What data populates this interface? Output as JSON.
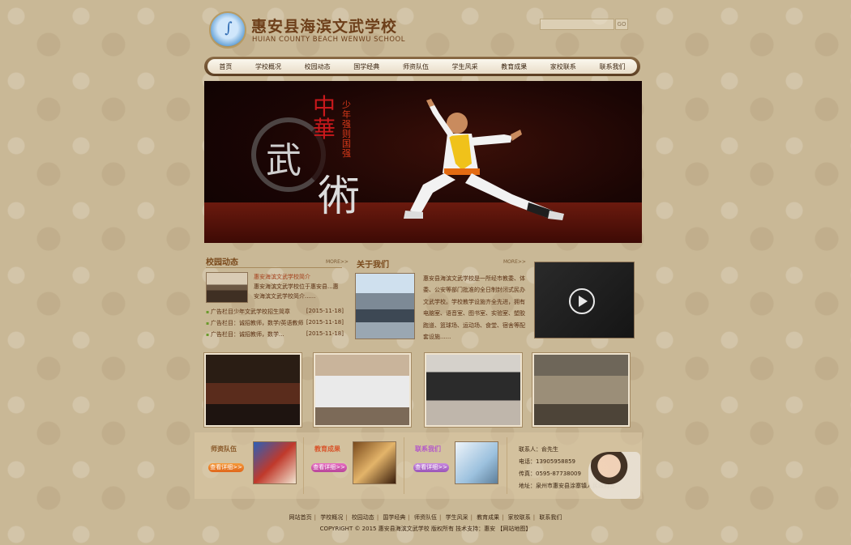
{
  "header": {
    "school_name": "惠安县海滨文武学校",
    "school_name_en": "HUIAN COUNTY BEACH WENWU SCHOOL",
    "search_button": "GO"
  },
  "nav": [
    "首页",
    "学校概况",
    "校园动态",
    "国学经典",
    "师资队伍",
    "学生风采",
    "教育成果",
    "家校联系",
    "联系我们"
  ],
  "banner": {
    "calligraphy_wu": "武",
    "calligraphy_zhonghua": "中華",
    "calligraphy_shu": "術",
    "slogan": "少年强则国强"
  },
  "news": {
    "title": "校园动态",
    "more": "MORE>>",
    "featured_title": "惠安海滨文武学校简介",
    "featured_text": "惠安海滨文武学校位于惠安县...惠安海滨文武学校简介......",
    "items": [
      {
        "title": "广告栏目少年文武学校招生简章",
        "date": "[2015-11-18]"
      },
      {
        "title": "广告栏目：诚招教师，数学/英语教师",
        "date": "[2015-11-18]"
      },
      {
        "title": "广告栏目：诚招教师，数学...",
        "date": "[2015-11-18]"
      }
    ]
  },
  "about": {
    "title": "关于我们",
    "more": "MORE>>",
    "text": "惠安县海滨文武学校是一所经市教委、体委、公安等部门批准的全日制封闭式民办文武学校。学校教学设施齐全先进，拥有电脑室、语音室、图书室、实验室、塑胶跑道、篮球场、运动场、食堂、宿舍等配套设施......"
  },
  "gallery": [
    "photo-1",
    "photo-2",
    "photo-3",
    "photo-4"
  ],
  "boxes": {
    "teachers": {
      "title": "师资队伍",
      "button": "查看详细>>"
    },
    "results": {
      "title": "教育成果",
      "button": "查看详细>>"
    },
    "contact": {
      "title": "联系我们",
      "button": "查看详细>>"
    }
  },
  "contact_info": {
    "person": "联系人：俞先生",
    "phone": "电话：13905958859",
    "fax": "传真：0595-87738009",
    "address": "地址：泉州市惠安县涂寨镇人民政府旁"
  },
  "footer": {
    "links": [
      "网站首页",
      "学校概况",
      "校园动态",
      "国学经典",
      "师资队伍",
      "学生风采",
      "教育成果",
      "家校联系",
      "联系我们"
    ],
    "copyright": "COPYRIGHT © 2015 惠安县海滨文武学校 版权所有 技术支持：惠安 【网站地图】"
  },
  "colors": {
    "brand_brown": "#6d3f1a",
    "accent_red": "#c8191c"
  }
}
